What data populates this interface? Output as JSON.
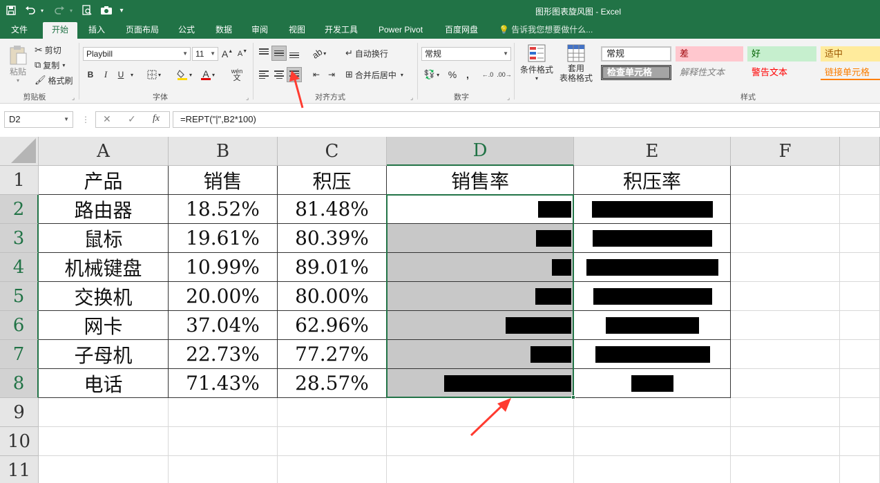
{
  "quick_access": {
    "save_icon": "save-icon",
    "undo_icon": "undo-icon",
    "redo_icon": "redo-icon",
    "preview_icon": "print-preview-icon",
    "camera_icon": "camera-icon",
    "customize_icon": "customize-toolbar-icon"
  },
  "window_title": "图形图表旋风图 - Excel",
  "tabs": [
    {
      "label": "文件"
    },
    {
      "label": "开始"
    },
    {
      "label": "插入"
    },
    {
      "label": "页面布局"
    },
    {
      "label": "公式"
    },
    {
      "label": "数据"
    },
    {
      "label": "审阅"
    },
    {
      "label": "视图"
    },
    {
      "label": "开发工具"
    },
    {
      "label": "Power Pivot"
    },
    {
      "label": "百度网盘"
    }
  ],
  "tell_me": "告诉我您想要做什么...",
  "ribbon": {
    "clipboard": {
      "paste": "粘贴",
      "cut": "剪切",
      "copy": "复制",
      "format_painter": "格式刷",
      "group": "剪贴板"
    },
    "font": {
      "font_name": "Playbill",
      "font_size": "11",
      "bold": "B",
      "italic": "I",
      "underline": "U",
      "grow": "A",
      "shrink": "A",
      "wen": "wén",
      "group": "字体"
    },
    "alignment": {
      "wrap_text": "自动换行",
      "merge_center": "合并后居中",
      "group": "对齐方式"
    },
    "number": {
      "format": "常规",
      "percent": "%",
      "comma": ",",
      "group": "数字"
    },
    "styles": {
      "conditional": "条件格式",
      "table_format_1": "套用",
      "table_format_2": "表格格式",
      "normal": "常规",
      "bad": "差",
      "good": "好",
      "neutral": "适中",
      "check_cell": "检查单元格",
      "explanatory": "解释性文本",
      "warning": "警告文本",
      "linked": "链接单元格",
      "group": "样式"
    }
  },
  "namebox": "D2",
  "formula": "=REPT(\"|\",B2*100)",
  "columns": [
    "A",
    "B",
    "C",
    "D",
    "E",
    "F"
  ],
  "rows": [
    "1",
    "2",
    "3",
    "4",
    "5",
    "6",
    "7",
    "8",
    "9",
    "10",
    "11"
  ],
  "table": {
    "headers": [
      "产品",
      "销售",
      "积压",
      "销售率",
      "积压率"
    ],
    "data": [
      {
        "product": "路由器",
        "sales": "18.52%",
        "backlog": "81.48%",
        "sales_rate": 18.52,
        "backlog_rate": 81.48
      },
      {
        "product": "鼠标",
        "sales": "19.61%",
        "backlog": "80.39%",
        "sales_rate": 19.61,
        "backlog_rate": 80.39
      },
      {
        "product": "机械键盘",
        "sales": "10.99%",
        "backlog": "89.01%",
        "sales_rate": 10.99,
        "backlog_rate": 89.01
      },
      {
        "product": "交换机",
        "sales": "20.00%",
        "backlog": "80.00%",
        "sales_rate": 20.0,
        "backlog_rate": 80.0
      },
      {
        "product": "网卡",
        "sales": "37.04%",
        "backlog": "62.96%",
        "sales_rate": 37.04,
        "backlog_rate": 62.96
      },
      {
        "product": "子母机",
        "sales": "22.73%",
        "backlog": "77.27%",
        "sales_rate": 22.73,
        "backlog_rate": 77.27
      },
      {
        "product": "电话",
        "sales": "71.43%",
        "backlog": "28.57%",
        "sales_rate": 71.43,
        "backlog_rate": 28.57
      }
    ]
  },
  "colors": {
    "excel_green": "#217346",
    "annotation_red": "#ff3b30",
    "selection_shade": "#c8c8c8",
    "bar": "#000000"
  }
}
